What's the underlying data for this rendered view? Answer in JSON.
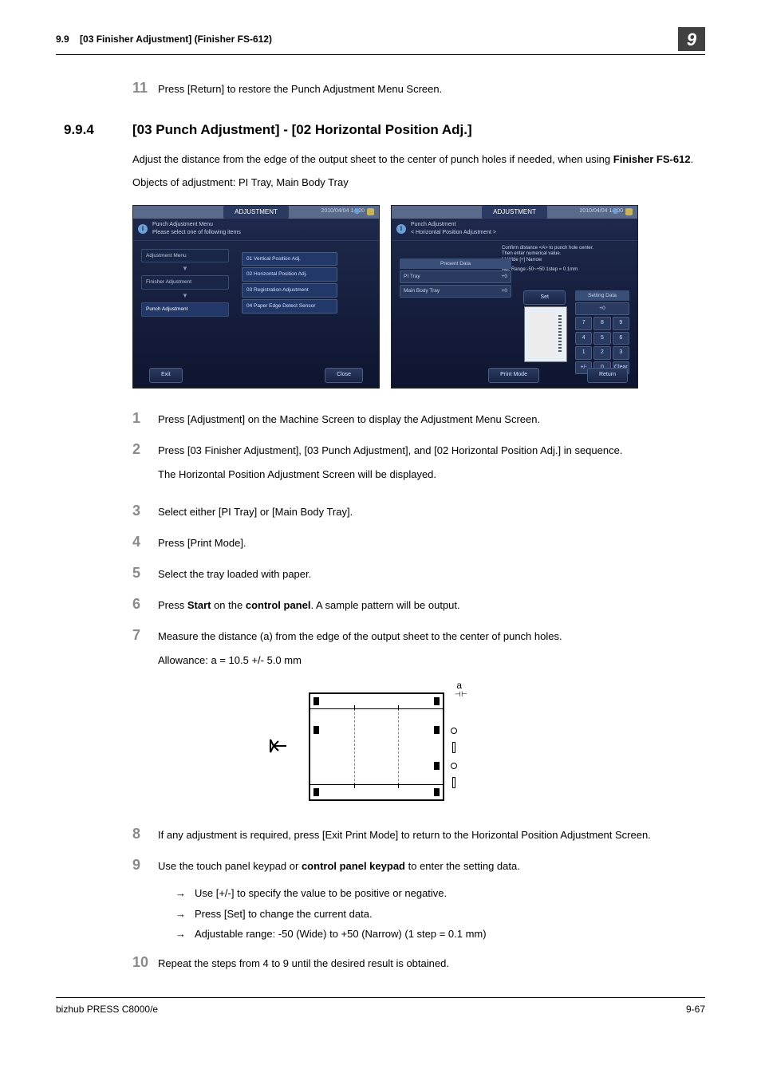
{
  "header": {
    "section_no": "9.9",
    "section_title": "[03 Finisher Adjustment] (Finisher FS-612)",
    "chapter": "9"
  },
  "carry_step": {
    "num": "11",
    "text": "Press [Return] to restore the Punch Adjustment Menu Screen."
  },
  "section": {
    "num": "9.9.4",
    "title": "[03 Punch Adjustment] - [02 Horizontal Position Adj.]"
  },
  "intro": {
    "line1_a": "Adjust the distance from the edge of the output sheet to the center of punch holes if needed, when using ",
    "line1_b": "Finisher FS-612",
    "line1_c": ".",
    "line2": "Objects of adjustment: PI Tray, Main Body Tray"
  },
  "ss1": {
    "tab": "ADJUSTMENT",
    "time": "2010/04/04  14:00",
    "info_line1": "Punch Adjustment Menu",
    "info_line2": "Please select one of following items",
    "menu": {
      "m1": "Adjustment Menu",
      "m2": "Finisher Adjustment",
      "m3": "Punch Adjustment"
    },
    "opts": {
      "o1": "01 Vertical Position Adj.",
      "o2": "02 Horizontal Position Adj.",
      "o3": "03 Registration Adjustment",
      "o4": "04 Paper Edge Detect Sensor"
    },
    "exit": "Exit",
    "close": "Close"
  },
  "ss2": {
    "tab": "ADJUSTMENT",
    "time": "2010/04/04  14:00",
    "info_line1": "Punch Adjustment",
    "info_line2": "< Horizontal Position Adjustment >",
    "hint1": "Confirm distance <A> to punch hole center.",
    "hint2": "Then enter numerical value.",
    "hint3": "[-] Wide  [+] Narrow",
    "hint4": "Adj. Range:-50~+50 1step = 0.1mm",
    "present": "Present Data",
    "tray1": "PI Tray",
    "tray1v": "+0",
    "tray2": "Main Body Tray",
    "tray2v": "+0",
    "set": "Set",
    "setting": "Setting Data",
    "setv": "+0",
    "keys": {
      "k7": "7",
      "k8": "8",
      "k9": "9",
      "k4": "4",
      "k5": "5",
      "k6": "6",
      "k1": "1",
      "k2": "2",
      "k3": "3",
      "pm": "+/-",
      "k0": "0",
      "clear": "Clear"
    },
    "print": "Print Mode",
    "return": "Return"
  },
  "diagram": {
    "a_label": "a"
  },
  "steps": {
    "s1": {
      "n": "1",
      "t": "Press [Adjustment] on the Machine Screen to display the Adjustment Menu Screen."
    },
    "s2": {
      "n": "2",
      "t1": "Press [03 Finisher Adjustment], [03 Punch Adjustment], and [02 Horizontal Position Adj.] in sequence.",
      "t2": "The Horizontal Position Adjustment Screen will be displayed."
    },
    "s3": {
      "n": "3",
      "t": "Select either [PI Tray] or [Main Body Tray]."
    },
    "s4": {
      "n": "4",
      "t": "Press [Print Mode]."
    },
    "s5": {
      "n": "5",
      "t": "Select the tray loaded with paper."
    },
    "s6": {
      "n": "6",
      "a": "Press ",
      "b": "Start",
      "c": " on the ",
      "d": "control panel",
      "e": ". A sample pattern will be output."
    },
    "s7": {
      "n": "7",
      "t1": " Measure the distance (a) from the edge of the output sheet to the center of punch holes.",
      "t2": "Allowance: a = 10.5 +/- 5.0 mm"
    },
    "s8": {
      "n": "8",
      "t": "If any adjustment is required, press [Exit Print Mode] to return to the Horizontal Position Adjustment Screen."
    },
    "s9": {
      "n": "9",
      "a": "Use the touch panel keypad or ",
      "b": "control panel keypad",
      "c": " to enter the setting data.",
      "sub1": "Use [+/-] to specify the value to be positive or negative.",
      "sub2": "Press [Set] to change the current data.",
      "sub3": "Adjustable range: -50 (Wide) to +50 (Narrow) (1 step = 0.1 mm)"
    },
    "s10": {
      "n": "10",
      "t": "Repeat the steps from 4 to 9 until the desired result is obtained."
    }
  },
  "footer": {
    "model": "bizhub PRESS C8000/e",
    "page": "9-67"
  }
}
